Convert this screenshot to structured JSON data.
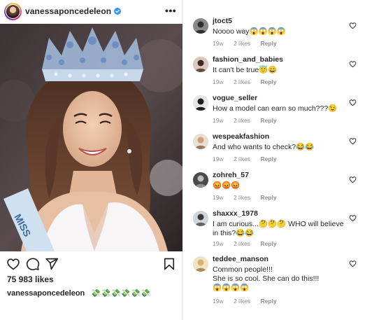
{
  "post": {
    "username": "vanessaponcedeleon",
    "likes": "75 983 likes",
    "caption_user": "vanessaponcedeleon",
    "caption_text": "💸💸💸💸💸💸"
  },
  "icons": {
    "verified": "verified-badge-icon",
    "more": "more-options-icon",
    "like": "heart-outline-icon",
    "comment": "comment-bubble-icon",
    "share": "paper-plane-share-icon",
    "save": "bookmark-icon",
    "comment_like": "small-heart-icon"
  },
  "colors": {
    "verified_blue": "#3897f0",
    "meta_gray": "#8e8e8e",
    "text": "#262626",
    "divider": "#dbdbdb"
  },
  "comments": [
    {
      "user": "jtoct5",
      "text": "Noooo way😱😱😱😱",
      "age": "19w",
      "likes": "2 likes",
      "reply": "Reply"
    },
    {
      "user": "fashion_and_babies",
      "text": "It can't be true😇😄",
      "age": "19w",
      "likes": "2 likes",
      "reply": "Reply"
    },
    {
      "user": "vogue_seller",
      "text": "How a model can earn so much???😉",
      "age": "19w",
      "likes": "2 likes",
      "reply": "Reply"
    },
    {
      "user": "wespeakfashion",
      "text": "And who wants to check?😂😂",
      "age": "19w",
      "likes": "2 likes",
      "reply": "Reply"
    },
    {
      "user": "zohreh_57",
      "text": "😡😡😡",
      "age": "19w",
      "likes": "2 likes",
      "reply": "Reply"
    },
    {
      "user": "shaxxx_1978",
      "text": "I am curious...🤔🤔🤔 WHO will believe in this?😂😂",
      "age": "19w",
      "likes": "2 likes",
      "reply": "Reply"
    },
    {
      "user": "teddee_manson",
      "text_line1": "Common people!!!",
      "text_line2": "She is so cool. She can do this!!!",
      "text_line3": "😱😱😱😱",
      "age": "19w",
      "likes": "2 likes",
      "reply": "Reply"
    }
  ]
}
